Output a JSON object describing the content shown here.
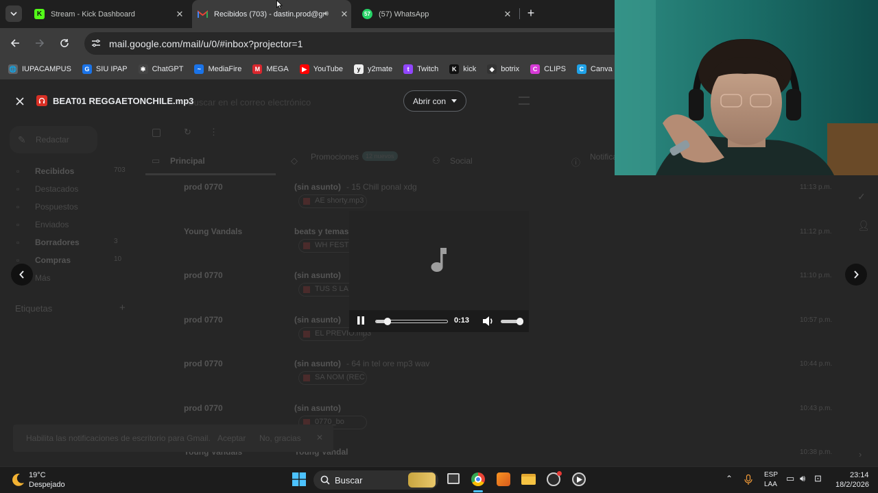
{
  "browser": {
    "tabs": [
      {
        "title": "Stream - Kick Dashboard",
        "favicon": "kick-icon",
        "active": false
      },
      {
        "title": "Recibidos (703) - dastin.prod@gm",
        "favicon": "gmail-icon",
        "active": true
      },
      {
        "title": "(57) WhatsApp",
        "favicon": "whatsapp-icon",
        "badge": "57",
        "active": false
      }
    ],
    "url": "mail.google.com/mail/u/0/#inbox?projector=1",
    "bookmarks": [
      {
        "label": "IUPACAMPUS",
        "color": "#5f6368",
        "glyph": "🌐"
      },
      {
        "label": "SIU IPAP",
        "color": "#1a73e8",
        "glyph": "G"
      },
      {
        "label": "ChatGPT",
        "color": "#444",
        "glyph": "✱"
      },
      {
        "label": "MediaFire",
        "color": "#1a73e8",
        "glyph": "~"
      },
      {
        "label": "MEGA",
        "color": "#d9272e",
        "glyph": "M"
      },
      {
        "label": "YouTube",
        "color": "#ff0000",
        "glyph": "▶"
      },
      {
        "label": "y2mate",
        "color": "#eee",
        "glyph": "y"
      },
      {
        "label": "Twitch",
        "color": "#9146ff",
        "glyph": "t"
      },
      {
        "label": "kick",
        "color": "#111",
        "glyph": "K"
      },
      {
        "label": "botrix",
        "color": "#333",
        "glyph": "◆"
      },
      {
        "label": "CLIPS",
        "color": "#d63ad6",
        "glyph": "C"
      },
      {
        "label": "Canva",
        "color": "#1fa2e8",
        "glyph": "C"
      },
      {
        "label": "",
        "color": "#1fa463",
        "glyph": "▲"
      }
    ]
  },
  "viewer": {
    "file_name": "BEAT01 REGGAETONCHILE.mp3",
    "open_with": "Abrir con",
    "player": {
      "time": "0:13",
      "progress": 0.14,
      "volume": 0.85
    }
  },
  "gmail_background": {
    "search_placeholder": "Buscar en el correo electrónico",
    "compose": "Redactar",
    "sidebar": [
      {
        "label": "Recibidos",
        "count": "703"
      },
      {
        "label": "Destacados",
        "count": ""
      },
      {
        "label": "Pospuestos",
        "count": ""
      },
      {
        "label": "Enviados",
        "count": ""
      },
      {
        "label": "Borradores",
        "count": "3"
      },
      {
        "label": "Compras",
        "count": "10"
      },
      {
        "label": "Más",
        "count": ""
      }
    ],
    "labels_heading": "Etiquetas",
    "tabs": [
      "Principal",
      "Promociones",
      "Social",
      "Notificaciones"
    ],
    "promo_badge": "12 nuevos",
    "rows": [
      {
        "sender": "prod 0770",
        "subject": "(sin asunto)",
        "snippet": "- 15 Chill ponal xdg",
        "time": "11:13 p.m.",
        "attach": "AE shorty.mp3"
      },
      {
        "sender": "Young Vandals",
        "subject": "beats y temas",
        "snippet": "",
        "time": "11:12 p.m.",
        "attach": "WH FEST"
      },
      {
        "sender": "prod 0770",
        "subject": "(sin asunto)",
        "snippet": "",
        "time": "11:10 p.m.",
        "attach": "TUS S LA"
      },
      {
        "sender": "prod 0770",
        "subject": "(sin asunto)",
        "snippet": "",
        "time": "10:57 p.m.",
        "attach": "EL PREVIO.mp3"
      },
      {
        "sender": "prod 0770",
        "subject": "(sin asunto)",
        "snippet": "- 64 in tel ore mp3 wav",
        "time": "10:44 p.m.",
        "attach": "SA NOM (REC"
      },
      {
        "sender": "prod 0770",
        "subject": "(sin asunto)",
        "snippet": "",
        "time": "10:43 p.m.",
        "attach": "0770_bo"
      },
      {
        "sender": "Young Vandals",
        "subject": "Young Vandal",
        "snippet": "",
        "time": "10:38 p.m.",
        "attach": ""
      }
    ],
    "toast": {
      "text": "Habilita las notificaciones de escritorio para Gmail.",
      "accept": "Aceptar",
      "decline": "No, gracias"
    }
  },
  "taskbar": {
    "weather_temp": "19°C",
    "weather_desc": "Despejado",
    "search_label": "Buscar",
    "lang_top": "ESP",
    "lang_bottom": "LAA",
    "time": "23:14",
    "date": "18/2/2026"
  }
}
